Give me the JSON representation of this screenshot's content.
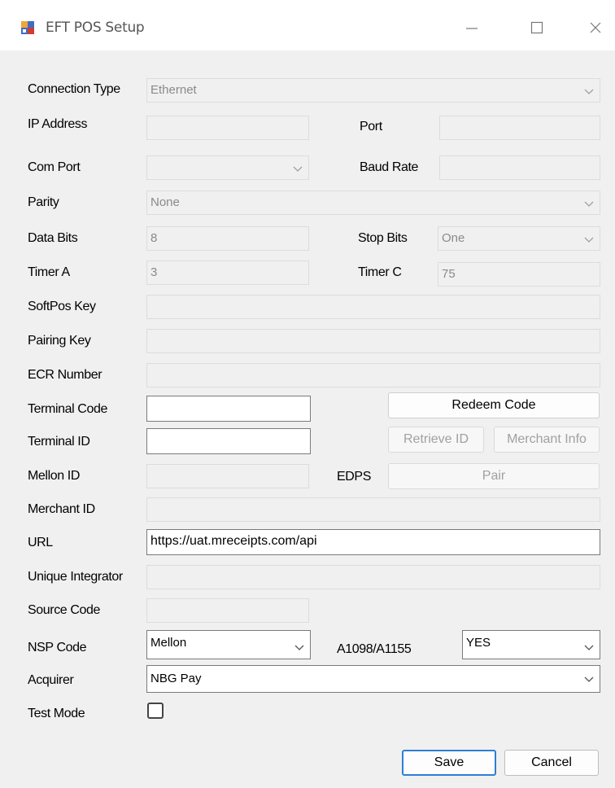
{
  "window": {
    "title": "EFT POS Setup"
  },
  "labels": {
    "connection_type": "Connection Type",
    "ip_address": "IP Address",
    "port": "Port",
    "com_port": "Com Port",
    "baud_rate": "Baud Rate",
    "parity": "Parity",
    "data_bits": "Data Bits",
    "stop_bits": "Stop Bits",
    "timer_a": "Timer A",
    "timer_c": "Timer C",
    "softpos_key": "SoftPos Key",
    "pairing_key": "Pairing Key",
    "ecr_number": "ECR Number",
    "terminal_code": "Terminal Code",
    "terminal_id": "Terminal ID",
    "mellon_id": "Mellon ID",
    "edps": "EDPS",
    "merchant_id": "Merchant ID",
    "url": "URL",
    "unique_integrator": "Unique Integrator",
    "source_code": "Source Code",
    "nsp_code": "NSP Code",
    "a1098": "A1098/A1155",
    "acquirer": "Acquirer",
    "test_mode": "Test Mode"
  },
  "values": {
    "connection_type": "Ethernet",
    "ip_address": "",
    "port": "",
    "com_port": "",
    "baud_rate": "",
    "parity": "None",
    "data_bits": "8",
    "stop_bits": "One",
    "timer_a": "3",
    "timer_c": "75",
    "softpos_key": "",
    "pairing_key": "",
    "ecr_number": "",
    "terminal_code": "",
    "terminal_id": "",
    "mellon_id": "",
    "merchant_id": "",
    "url": "https://uat.mreceipts.com/api",
    "unique_integrator": "",
    "source_code": "",
    "nsp_code": "Mellon",
    "a1098": "YES",
    "acquirer": "NBG Pay",
    "test_mode": false
  },
  "buttons": {
    "redeem_code": "Redeem Code",
    "retrieve_id": "Retrieve ID",
    "merchant_info": "Merchant Info",
    "pair": "Pair",
    "save": "Save",
    "cancel": "Cancel"
  },
  "icons": {
    "dropdown": "chevron-down-icon",
    "minimize": "minimize-icon",
    "maximize": "maximize-icon",
    "close": "close-icon",
    "app": "app-icon"
  },
  "colors": {
    "accent": "#2d7fd4",
    "background": "#f0f0f0"
  }
}
